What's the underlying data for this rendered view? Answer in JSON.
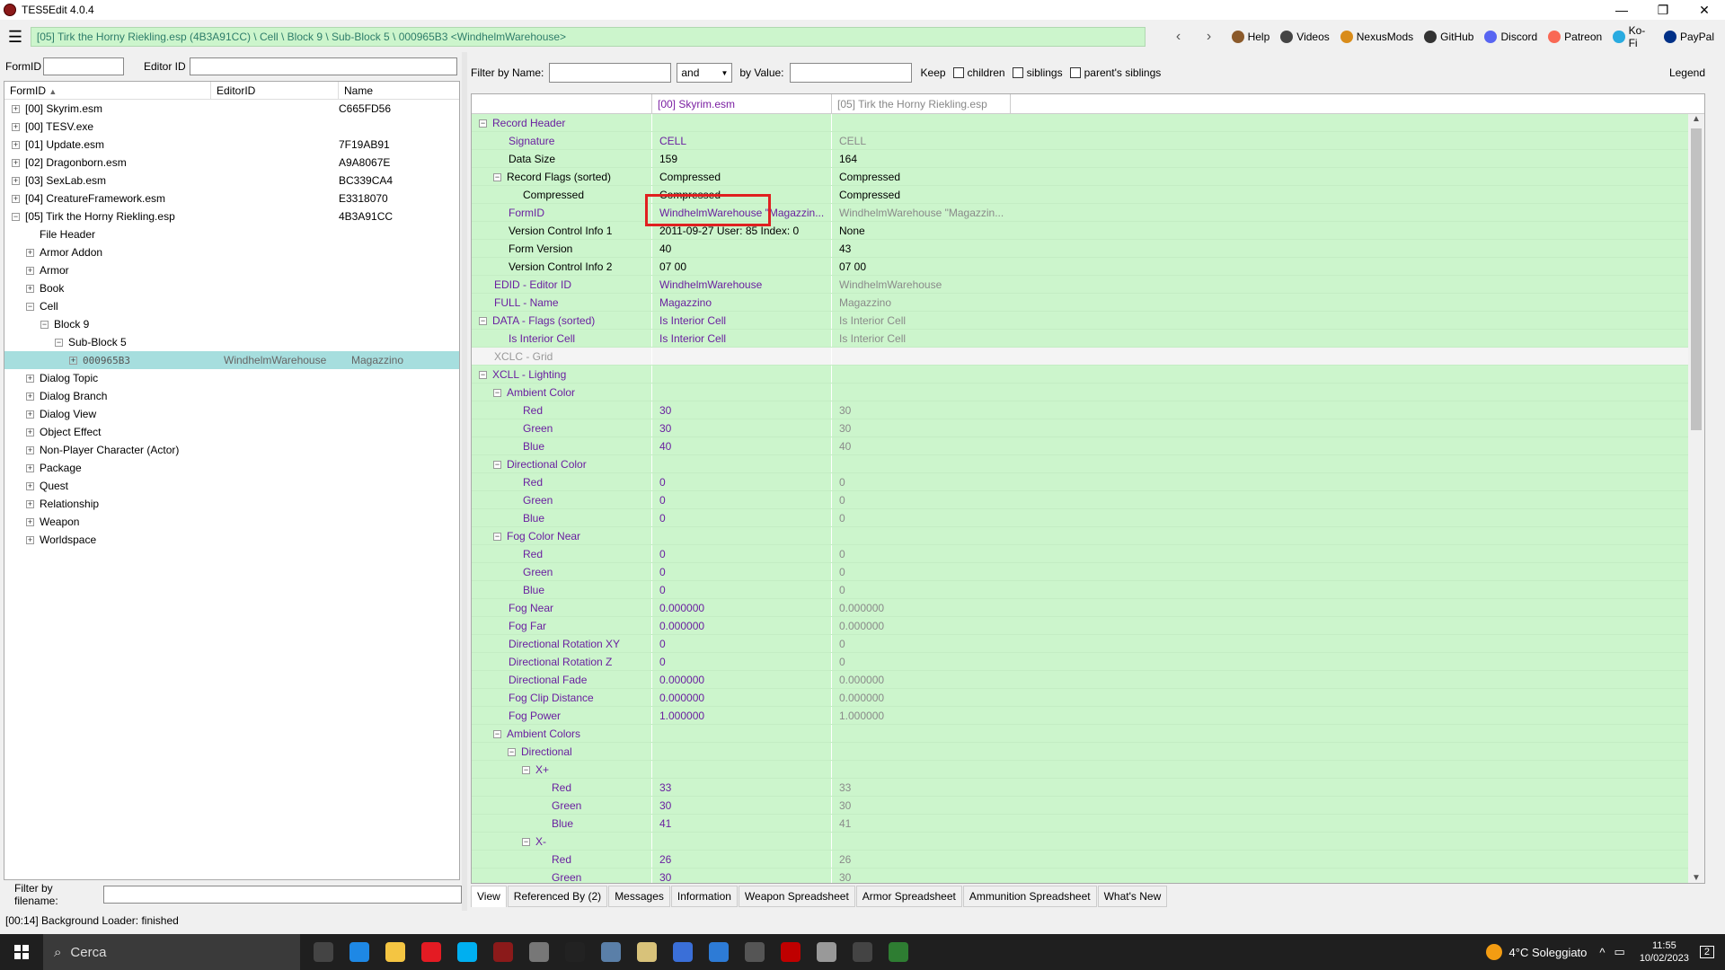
{
  "window": {
    "title": "TES5Edit 4.0.4",
    "min": "—",
    "restore": "❐",
    "close": "✕"
  },
  "path": "[05] Tirk the Horny Riekling.esp (4B3A91CC) \\ Cell \\ Block 9 \\ Sub-Block 5 \\ 000965B3 <WindhelmWarehouse>",
  "nav": {
    "back": "‹",
    "forward": "›"
  },
  "links": [
    {
      "label": "Help",
      "icon": "book-icon",
      "color": "#8b5a2b"
    },
    {
      "label": "Videos",
      "icon": "video-icon",
      "color": "#444"
    },
    {
      "label": "NexusMods",
      "icon": "nexus-icon",
      "color": "#d98c1a"
    },
    {
      "label": "GitHub",
      "icon": "github-icon",
      "color": "#333"
    },
    {
      "label": "Discord",
      "icon": "discord-icon",
      "color": "#5865f2"
    },
    {
      "label": "Patreon",
      "icon": "patreon-icon",
      "color": "#f96854"
    },
    {
      "label": "Ko-Fi",
      "icon": "kofi-icon",
      "color": "#29abe0"
    },
    {
      "label": "PayPal",
      "icon": "paypal-icon",
      "color": "#003087"
    }
  ],
  "left": {
    "formid_label": "FormID",
    "editorid_label": "Editor ID",
    "columns": [
      "FormID",
      "EditorID",
      "Name"
    ],
    "sort_arrow": "▲",
    "filter_filename_label": "Filter by filename:",
    "rows": [
      {
        "indent": 0,
        "exp": "+",
        "label": "[00] Skyrim.esm",
        "c2": "",
        "c3": "C665FD56"
      },
      {
        "indent": 0,
        "exp": "+",
        "label": "[00] TESV.exe",
        "c2": "",
        "c3": ""
      },
      {
        "indent": 0,
        "exp": "+",
        "label": "[01] Update.esm",
        "c2": "",
        "c3": "7F19AB91"
      },
      {
        "indent": 0,
        "exp": "+",
        "label": "[02] Dragonborn.esm",
        "c2": "",
        "c3": "A9A8067E"
      },
      {
        "indent": 0,
        "exp": "+",
        "label": "[03] SexLab.esm",
        "c2": "",
        "c3": "BC339CA4"
      },
      {
        "indent": 0,
        "exp": "+",
        "label": "[04] CreatureFramework.esm",
        "c2": "",
        "c3": "E3318070"
      },
      {
        "indent": 0,
        "exp": "−",
        "label": "[05] Tirk the Horny Riekling.esp",
        "c2": "",
        "c3": "4B3A91CC"
      },
      {
        "indent": 1,
        "exp": "",
        "label": "File Header",
        "c2": "",
        "c3": ""
      },
      {
        "indent": 1,
        "exp": "+",
        "label": "Armor Addon",
        "c2": "",
        "c3": ""
      },
      {
        "indent": 1,
        "exp": "+",
        "label": "Armor",
        "c2": "",
        "c3": ""
      },
      {
        "indent": 1,
        "exp": "+",
        "label": "Book",
        "c2": "",
        "c3": ""
      },
      {
        "indent": 1,
        "exp": "−",
        "label": "Cell",
        "c2": "",
        "c3": ""
      },
      {
        "indent": 2,
        "exp": "−",
        "label": "Block 9",
        "c2": "",
        "c3": ""
      },
      {
        "indent": 3,
        "exp": "−",
        "label": "Sub-Block 5",
        "c2": "",
        "c3": ""
      },
      {
        "indent": 4,
        "exp": "+",
        "label": "000965B3",
        "c2": "WindhelmWarehouse",
        "c3": "Magazzino",
        "selected": true
      },
      {
        "indent": 1,
        "exp": "+",
        "label": "Dialog Topic",
        "c2": "",
        "c3": ""
      },
      {
        "indent": 1,
        "exp": "+",
        "label": "Dialog Branch",
        "c2": "",
        "c3": ""
      },
      {
        "indent": 1,
        "exp": "+",
        "label": "Dialog View",
        "c2": "",
        "c3": ""
      },
      {
        "indent": 1,
        "exp": "+",
        "label": "Object Effect",
        "c2": "",
        "c3": ""
      },
      {
        "indent": 1,
        "exp": "+",
        "label": "Non-Player Character (Actor)",
        "c2": "",
        "c3": ""
      },
      {
        "indent": 1,
        "exp": "+",
        "label": "Package",
        "c2": "",
        "c3": ""
      },
      {
        "indent": 1,
        "exp": "+",
        "label": "Quest",
        "c2": "",
        "c3": ""
      },
      {
        "indent": 1,
        "exp": "+",
        "label": "Relationship",
        "c2": "",
        "c3": ""
      },
      {
        "indent": 1,
        "exp": "+",
        "label": "Weapon",
        "c2": "",
        "c3": ""
      },
      {
        "indent": 1,
        "exp": "+",
        "label": "Worldspace",
        "c2": "",
        "c3": ""
      }
    ]
  },
  "right": {
    "filter_name_label": "Filter by Name:",
    "and_select": "and",
    "by_value_label": "by Value:",
    "keep_label": "Keep",
    "children_label": "children",
    "siblings_label": "siblings",
    "parents_siblings_label": "parent's siblings",
    "legend_label": "Legend",
    "col1": "[00] Skyrim.esm",
    "col2": "[05] Tirk the Horny Riekling.esp",
    "rows": [
      {
        "indent": 0,
        "exp": "−",
        "name": "Record Header",
        "v1": "",
        "v2": "",
        "style": "purple"
      },
      {
        "indent": 1,
        "exp": "",
        "name": "Signature",
        "v1": "CELL",
        "v2": "CELL",
        "style": "purple",
        "v1c": "purple",
        "v2c": "gray"
      },
      {
        "indent": 1,
        "exp": "",
        "name": "Data Size",
        "v1": "159",
        "v2": "164",
        "style": "black",
        "v1c": "black",
        "v2c": "black"
      },
      {
        "indent": 1,
        "exp": "−",
        "name": "Record Flags (sorted)",
        "v1": "Compressed",
        "v2": "Compressed",
        "style": "black",
        "v1c": "black",
        "v2c": "black"
      },
      {
        "indent": 2,
        "exp": "",
        "name": "Compressed",
        "v1": "Compressed",
        "v2": "Compressed",
        "style": "black",
        "v1c": "black",
        "v2c": "black"
      },
      {
        "indent": 1,
        "exp": "",
        "name": "FormID",
        "v1": "WindhelmWarehouse \"Magazzin...",
        "v2": "WindhelmWarehouse \"Magazzin...",
        "style": "purple",
        "v1c": "purple",
        "v2c": "gray"
      },
      {
        "indent": 1,
        "exp": "",
        "name": "Version Control Info 1",
        "v1": "2011-09-27 User: 85 Index: 0",
        "v2": "None",
        "style": "black",
        "v1c": "black",
        "v2c": "black"
      },
      {
        "indent": 1,
        "exp": "",
        "name": "Form Version",
        "v1": "40",
        "v2": "43",
        "style": "black",
        "v1c": "black",
        "v2c": "black"
      },
      {
        "indent": 1,
        "exp": "",
        "name": "Version Control Info 2",
        "v1": "07 00",
        "v2": "07 00",
        "style": "black",
        "v1c": "black",
        "v2c": "black"
      },
      {
        "indent": 0,
        "exp": "",
        "name": "EDID - Editor ID",
        "v1": "WindhelmWarehouse",
        "v2": "WindhelmWarehouse",
        "style": "purple",
        "v1c": "purple",
        "v2c": "gray"
      },
      {
        "indent": 0,
        "exp": "",
        "name": "FULL - Name",
        "v1": "Magazzino",
        "v2": "Magazzino",
        "style": "purple",
        "v1c": "purple",
        "v2c": "gray"
      },
      {
        "indent": 0,
        "exp": "−",
        "name": "DATA - Flags (sorted)",
        "v1": "Is Interior Cell",
        "v2": "Is Interior Cell",
        "style": "purple",
        "v1c": "purple",
        "v2c": "gray"
      },
      {
        "indent": 1,
        "exp": "",
        "name": "Is Interior Cell",
        "v1": "Is Interior Cell",
        "v2": "Is Interior Cell",
        "style": "purple",
        "v1c": "purple",
        "v2c": "gray"
      },
      {
        "indent": 0,
        "exp": "",
        "name": "XCLC - Grid",
        "v1": "",
        "v2": "",
        "style": "gray",
        "gray": true
      },
      {
        "indent": 0,
        "exp": "−",
        "name": "XCLL - Lighting",
        "v1": "",
        "v2": "",
        "style": "purple"
      },
      {
        "indent": 1,
        "exp": "−",
        "name": "Ambient Color",
        "v1": "",
        "v2": "",
        "style": "purple"
      },
      {
        "indent": 2,
        "exp": "",
        "name": "Red",
        "v1": "30",
        "v2": "30",
        "style": "purple",
        "v1c": "purple",
        "v2c": "gray"
      },
      {
        "indent": 2,
        "exp": "",
        "name": "Green",
        "v1": "30",
        "v2": "30",
        "style": "purple",
        "v1c": "purple",
        "v2c": "gray"
      },
      {
        "indent": 2,
        "exp": "",
        "name": "Blue",
        "v1": "40",
        "v2": "40",
        "style": "purple",
        "v1c": "purple",
        "v2c": "gray"
      },
      {
        "indent": 1,
        "exp": "−",
        "name": "Directional Color",
        "v1": "",
        "v2": "",
        "style": "purple"
      },
      {
        "indent": 2,
        "exp": "",
        "name": "Red",
        "v1": "0",
        "v2": "0",
        "style": "purple",
        "v1c": "purple",
        "v2c": "gray"
      },
      {
        "indent": 2,
        "exp": "",
        "name": "Green",
        "v1": "0",
        "v2": "0",
        "style": "purple",
        "v1c": "purple",
        "v2c": "gray"
      },
      {
        "indent": 2,
        "exp": "",
        "name": "Blue",
        "v1": "0",
        "v2": "0",
        "style": "purple",
        "v1c": "purple",
        "v2c": "gray"
      },
      {
        "indent": 1,
        "exp": "−",
        "name": "Fog Color Near",
        "v1": "",
        "v2": "",
        "style": "purple"
      },
      {
        "indent": 2,
        "exp": "",
        "name": "Red",
        "v1": "0",
        "v2": "0",
        "style": "purple",
        "v1c": "purple",
        "v2c": "gray"
      },
      {
        "indent": 2,
        "exp": "",
        "name": "Green",
        "v1": "0",
        "v2": "0",
        "style": "purple",
        "v1c": "purple",
        "v2c": "gray"
      },
      {
        "indent": 2,
        "exp": "",
        "name": "Blue",
        "v1": "0",
        "v2": "0",
        "style": "purple",
        "v1c": "purple",
        "v2c": "gray"
      },
      {
        "indent": 1,
        "exp": "",
        "name": "Fog Near",
        "v1": "0.000000",
        "v2": "0.000000",
        "style": "purple",
        "v1c": "purple",
        "v2c": "gray"
      },
      {
        "indent": 1,
        "exp": "",
        "name": "Fog Far",
        "v1": "0.000000",
        "v2": "0.000000",
        "style": "purple",
        "v1c": "purple",
        "v2c": "gray"
      },
      {
        "indent": 1,
        "exp": "",
        "name": "Directional Rotation XY",
        "v1": "0",
        "v2": "0",
        "style": "purple",
        "v1c": "purple",
        "v2c": "gray"
      },
      {
        "indent": 1,
        "exp": "",
        "name": "Directional Rotation Z",
        "v1": "0",
        "v2": "0",
        "style": "purple",
        "v1c": "purple",
        "v2c": "gray"
      },
      {
        "indent": 1,
        "exp": "",
        "name": "Directional Fade",
        "v1": "0.000000",
        "v2": "0.000000",
        "style": "purple",
        "v1c": "purple",
        "v2c": "gray"
      },
      {
        "indent": 1,
        "exp": "",
        "name": "Fog Clip Distance",
        "v1": "0.000000",
        "v2": "0.000000",
        "style": "purple",
        "v1c": "purple",
        "v2c": "gray"
      },
      {
        "indent": 1,
        "exp": "",
        "name": "Fog Power",
        "v1": "1.000000",
        "v2": "1.000000",
        "style": "purple",
        "v1c": "purple",
        "v2c": "gray"
      },
      {
        "indent": 1,
        "exp": "−",
        "name": "Ambient Colors",
        "v1": "",
        "v2": "",
        "style": "purple"
      },
      {
        "indent": 2,
        "exp": "−",
        "name": "Directional",
        "v1": "",
        "v2": "",
        "style": "purple"
      },
      {
        "indent": 3,
        "exp": "−",
        "name": "X+",
        "v1": "",
        "v2": "",
        "style": "purple"
      },
      {
        "indent": 4,
        "exp": "",
        "name": "Red",
        "v1": "33",
        "v2": "33",
        "style": "purple",
        "v1c": "purple",
        "v2c": "gray"
      },
      {
        "indent": 4,
        "exp": "",
        "name": "Green",
        "v1": "30",
        "v2": "30",
        "style": "purple",
        "v1c": "purple",
        "v2c": "gray"
      },
      {
        "indent": 4,
        "exp": "",
        "name": "Blue",
        "v1": "41",
        "v2": "41",
        "style": "purple",
        "v1c": "purple",
        "v2c": "gray"
      },
      {
        "indent": 3,
        "exp": "−",
        "name": "X-",
        "v1": "",
        "v2": "",
        "style": "purple"
      },
      {
        "indent": 4,
        "exp": "",
        "name": "Red",
        "v1": "26",
        "v2": "26",
        "style": "purple",
        "v1c": "purple",
        "v2c": "gray"
      },
      {
        "indent": 4,
        "exp": "",
        "name": "Green",
        "v1": "30",
        "v2": "30",
        "style": "purple",
        "v1c": "purple",
        "v2c": "gray"
      }
    ],
    "tabs": [
      "View",
      "Referenced By (2)",
      "Messages",
      "Information",
      "Weapon Spreadsheet",
      "Armor Spreadsheet",
      "Ammunition Spreadsheet",
      "What's New"
    ],
    "active_tab": "View"
  },
  "status": "[00:14] Background Loader: finished",
  "taskbar": {
    "search_placeholder": "Cerca",
    "apps": [
      {
        "name": "task-view-icon",
        "color": "#444"
      },
      {
        "name": "edge-icon",
        "color": "#1e88e5"
      },
      {
        "name": "explorer-icon",
        "color": "#f4c542"
      },
      {
        "name": "opera-icon",
        "color": "#e41b23"
      },
      {
        "name": "skype-icon",
        "color": "#00aff0"
      },
      {
        "name": "tes5edit-icon",
        "color": "#8b1a1a"
      },
      {
        "name": "castle-icon",
        "color": "#777"
      },
      {
        "name": "terminal-icon",
        "color": "#222"
      },
      {
        "name": "steam-icon",
        "color": "#5a7fa8"
      },
      {
        "name": "game-icon",
        "color": "#d8c27a"
      },
      {
        "name": "feather-icon",
        "color": "#3a6fd8"
      },
      {
        "name": "window-icon",
        "color": "#2d7bd6"
      },
      {
        "name": "launcher-icon",
        "color": "#555"
      },
      {
        "name": "filezilla-icon",
        "color": "#bf0000"
      },
      {
        "name": "app99-icon",
        "color": "#999"
      },
      {
        "name": "arrow-icon",
        "color": "#444"
      },
      {
        "name": "spreadsheet-icon",
        "color": "#2e7d32"
      }
    ],
    "weather": "4°C Soleggiato",
    "time": "11:55",
    "date": "10/02/2023",
    "notif": "2"
  }
}
